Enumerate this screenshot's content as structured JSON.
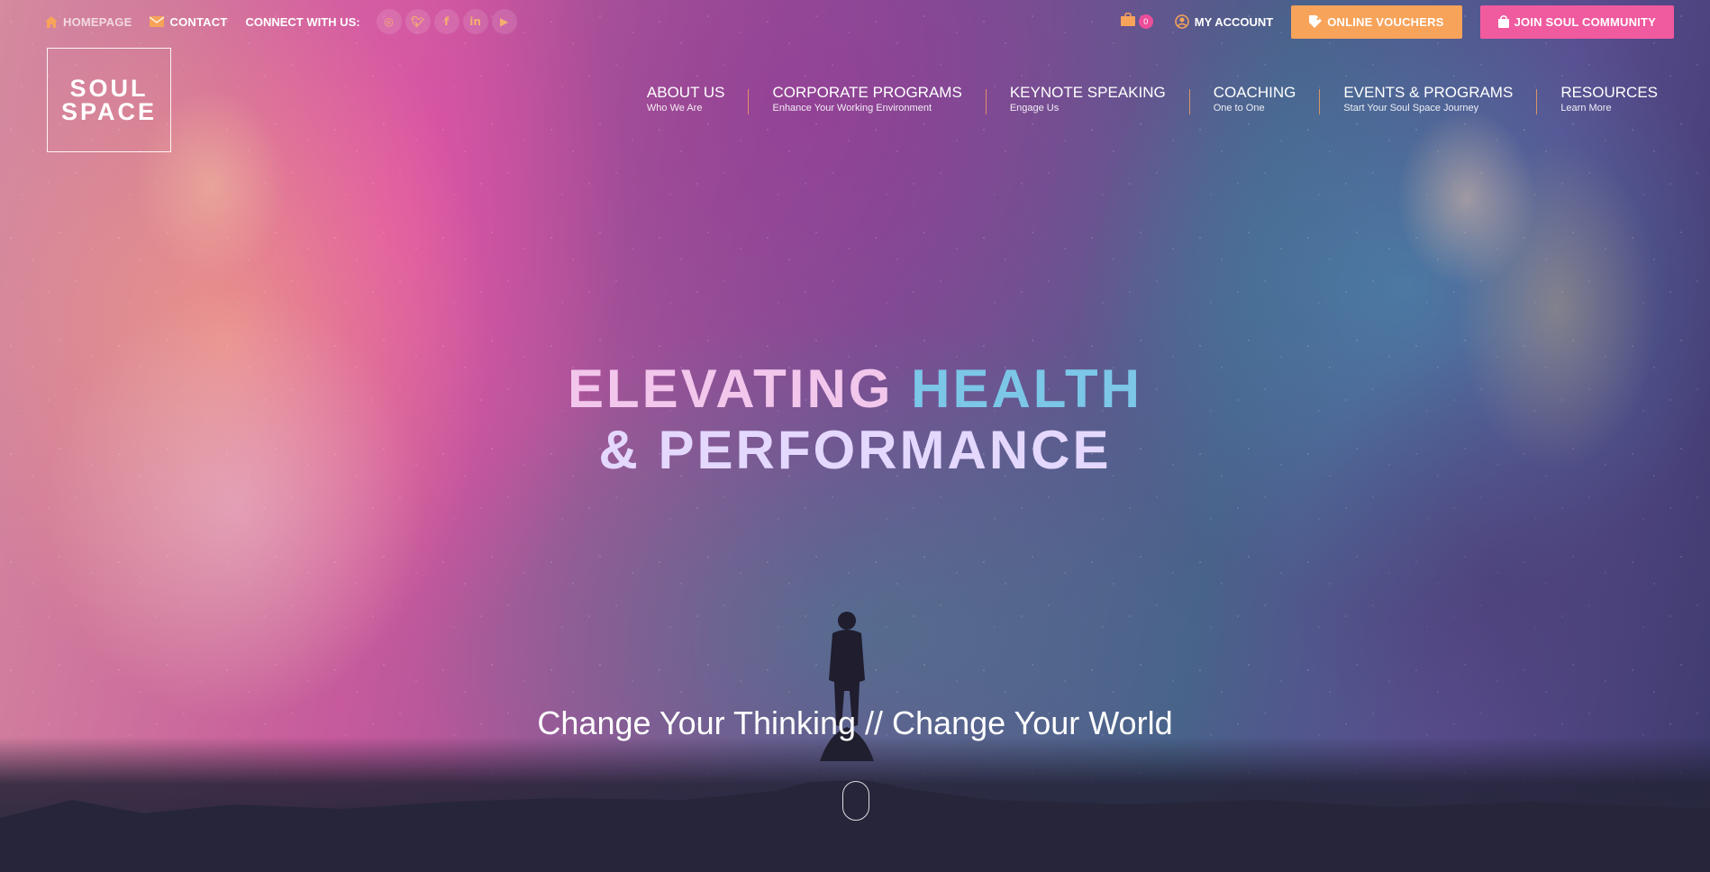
{
  "topbar": {
    "homepage_label": "HOMEPAGE",
    "contact_label": "CONTACT",
    "connect_label": "CONNECT WITH US:",
    "socials": [
      "instagram-icon",
      "twitter-icon",
      "facebook-icon",
      "linkedin-icon",
      "youtube-icon"
    ],
    "cart_count": "0",
    "account_label": "MY ACCOUNT",
    "vouchers_label": "ONLINE VOUCHERS",
    "community_label": "JOIN SOUL COMMUNITY"
  },
  "logo": {
    "line1": "SOUL",
    "line2": "SPACE"
  },
  "nav": [
    {
      "title": "ABOUT US",
      "sub": "Who We Are"
    },
    {
      "title": "CORPORATE PROGRAMS",
      "sub": "Enhance Your Working Environment"
    },
    {
      "title": "KEYNOTE SPEAKING",
      "sub": "Engage Us"
    },
    {
      "title": "COACHING",
      "sub": "One to One"
    },
    {
      "title": "EVENTS & PROGRAMS",
      "sub": "Start Your Soul Space Journey"
    },
    {
      "title": "RESOURCES",
      "sub": "Learn More"
    }
  ],
  "hero": {
    "headline_part1": "ELEVATING",
    "headline_part2": "HEALTH",
    "headline_line2": "& PERFORMANCE",
    "tagline": "Change Your Thinking // Change Your World"
  },
  "colors": {
    "vouchers_button": "#f7a35a",
    "community_button": "#f05a9f",
    "accent_separator": "#f7a35a"
  }
}
